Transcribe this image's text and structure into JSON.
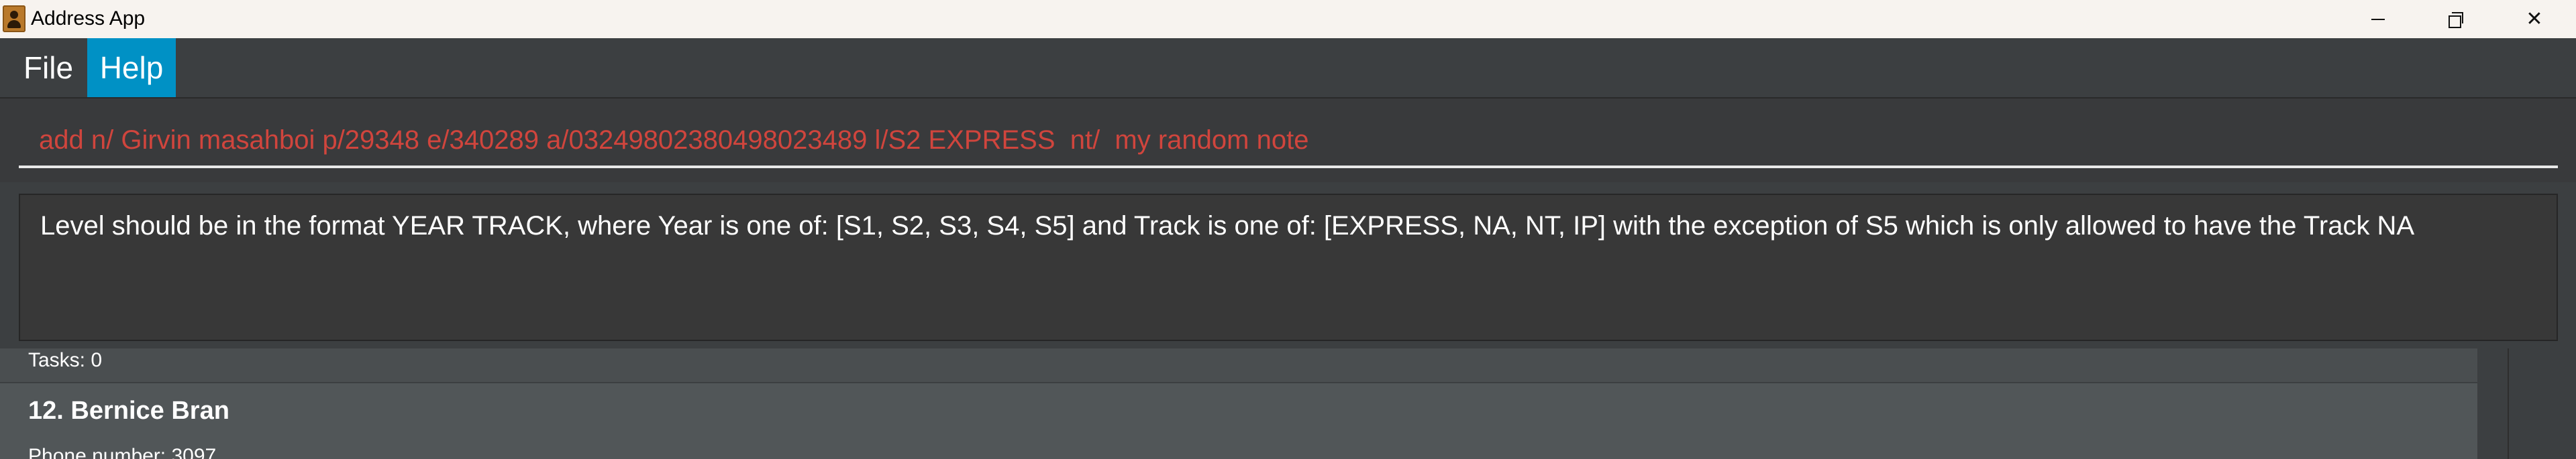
{
  "window": {
    "title": "Address App"
  },
  "menu": {
    "items": [
      {
        "label": "File"
      },
      {
        "label": "Help"
      }
    ]
  },
  "command": {
    "value": "add n/ Girvin masahboi p/29348 e/340289 a/03249802380498023489 l/S2 EXPRESS  nt/  my random note"
  },
  "result": {
    "message": "Level should be in the format YEAR TRACK, where Year is one of: [S1, S2, S3, S4, S5] and Track is one of: [EXPRESS, NA, NT, IP] with the exception of S5 which is only allowed to have the Track NA"
  },
  "person_list": {
    "previous_card": {
      "tasks": "Tasks: 0"
    },
    "cards": [
      {
        "name": "12. Bernice Bran",
        "phone": "Phone number: 3097"
      }
    ]
  },
  "colors": {
    "accent": "#0091c5",
    "error_text": "#d0453d",
    "background": "#3c3f41",
    "titlebar": "#f7f3ef"
  }
}
